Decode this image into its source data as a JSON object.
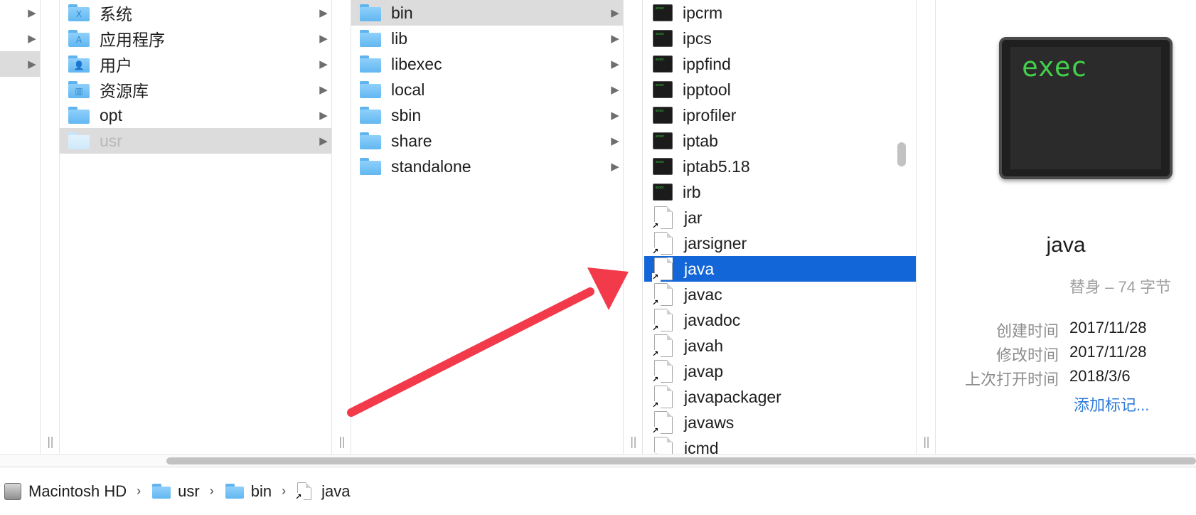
{
  "column1": {
    "items": [
      {
        "label": "系统",
        "icon": "system-folder-icon",
        "glyph": "X"
      },
      {
        "label": "应用程序",
        "icon": "applications-folder-icon",
        "glyph": "A"
      },
      {
        "label": "用户",
        "icon": "users-folder-icon",
        "glyph": "👤"
      },
      {
        "label": "资源库",
        "icon": "library-folder-icon",
        "glyph": "▥"
      },
      {
        "label": "opt",
        "icon": "folder-icon"
      },
      {
        "label": "usr",
        "icon": "folder-icon"
      }
    ]
  },
  "column2": {
    "items": [
      {
        "label": "bin"
      },
      {
        "label": "lib"
      },
      {
        "label": "libexec"
      },
      {
        "label": "local"
      },
      {
        "label": "sbin"
      },
      {
        "label": "share"
      },
      {
        "label": "standalone"
      }
    ]
  },
  "column3": {
    "items": [
      {
        "label": "ipcrm",
        "type": "exec"
      },
      {
        "label": "ipcs",
        "type": "exec"
      },
      {
        "label": "ippfind",
        "type": "exec"
      },
      {
        "label": "ipptool",
        "type": "exec"
      },
      {
        "label": "iprofiler",
        "type": "exec"
      },
      {
        "label": "iptab",
        "type": "exec"
      },
      {
        "label": "iptab5.18",
        "type": "exec"
      },
      {
        "label": "irb",
        "type": "exec"
      },
      {
        "label": "jar",
        "type": "alias"
      },
      {
        "label": "jarsigner",
        "type": "alias"
      },
      {
        "label": "java",
        "type": "alias"
      },
      {
        "label": "javac",
        "type": "alias"
      },
      {
        "label": "javadoc",
        "type": "alias"
      },
      {
        "label": "javah",
        "type": "alias"
      },
      {
        "label": "javap",
        "type": "alias"
      },
      {
        "label": "javapackager",
        "type": "alias"
      },
      {
        "label": "javaws",
        "type": "alias"
      },
      {
        "label": "jcmd",
        "type": "alias"
      }
    ]
  },
  "preview": {
    "icon_text": "exec",
    "name": "java",
    "kind": "替身 – 74 字节",
    "created_label": "创建时间",
    "created": "2017/11/28",
    "modified_label": "修改时间",
    "modified": "2017/11/28",
    "opened_label": "上次打开时间",
    "opened": "2018/3/6",
    "add_tags": "添加标记..."
  },
  "pathbar": {
    "items": [
      "Macintosh HD",
      "usr",
      "bin",
      "java"
    ]
  },
  "colors": {
    "selection_blue": "#1366d8",
    "selection_gray": "#dcdcdc",
    "arrow_red": "#f23a4a",
    "link_blue": "#2c7ad8",
    "exec_green": "#42d04a"
  }
}
